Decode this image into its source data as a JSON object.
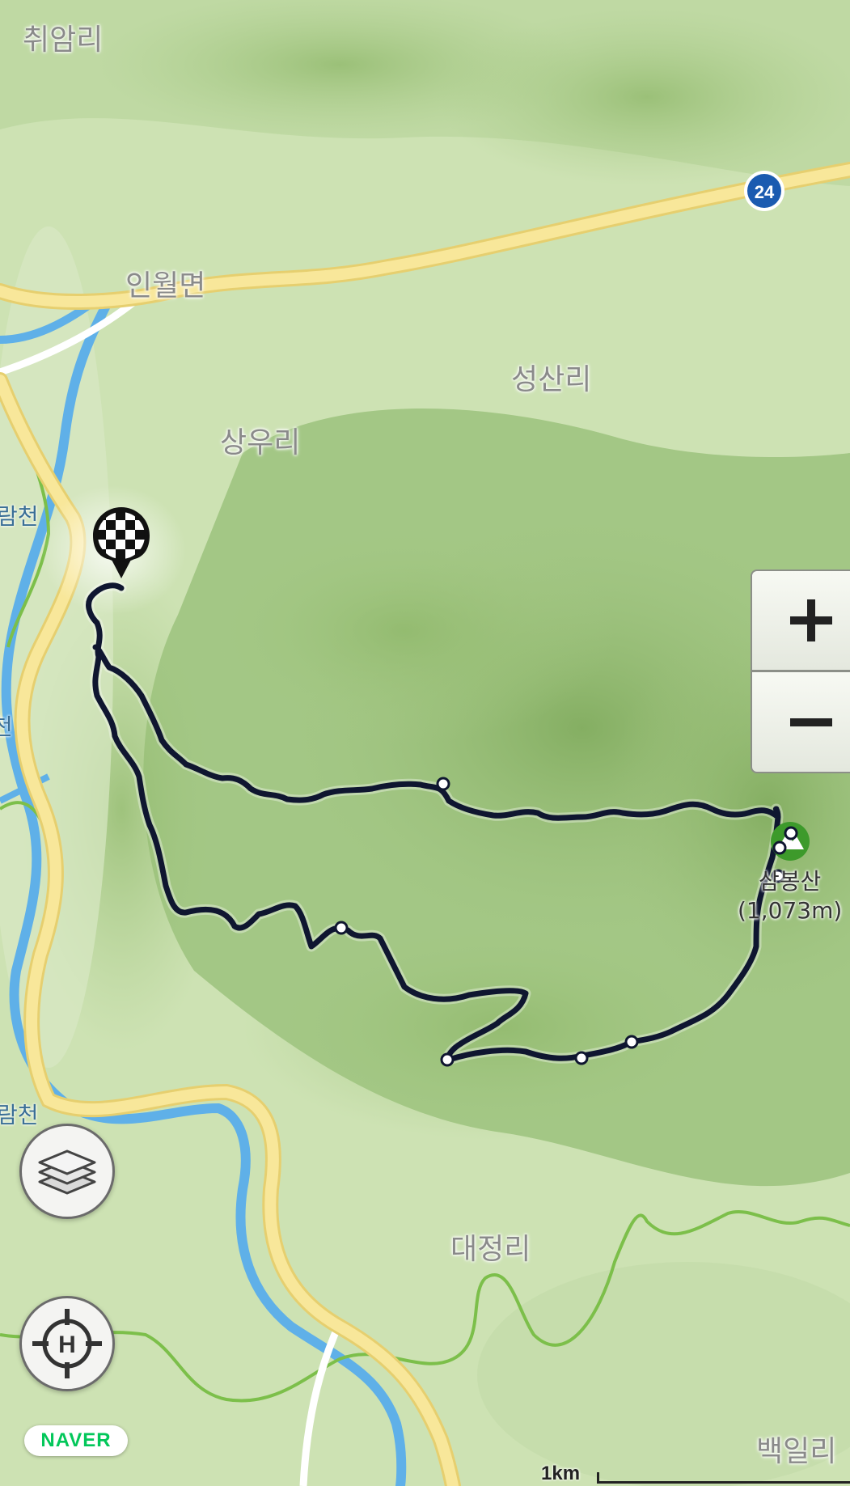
{
  "places": {
    "chwiam": "취암리",
    "inwol": "인월면",
    "seongsan": "성산리",
    "sangu": "상우리",
    "daejeong": "대정리",
    "baegil": "백일리"
  },
  "rivers": {
    "ram_upper": "람천",
    "ram_mid": "천",
    "ram_lower": "람천"
  },
  "road": {
    "route_number": "24"
  },
  "peak": {
    "name": "삼봉산",
    "elevation": "(1,073m)"
  },
  "controls": {
    "zoom_in_icon": "plus-icon",
    "zoom_out_icon": "minus-icon",
    "layers_icon": "layers-icon",
    "home_icon": "crosshair-h-icon"
  },
  "brand": "NAVER",
  "scale": {
    "label": "1km"
  },
  "colors": {
    "track": "#0f1630",
    "road": "#f6e28c",
    "river": "#5fb0e8",
    "boundary": "#7cbf4a",
    "naver_green": "#03c75a"
  }
}
